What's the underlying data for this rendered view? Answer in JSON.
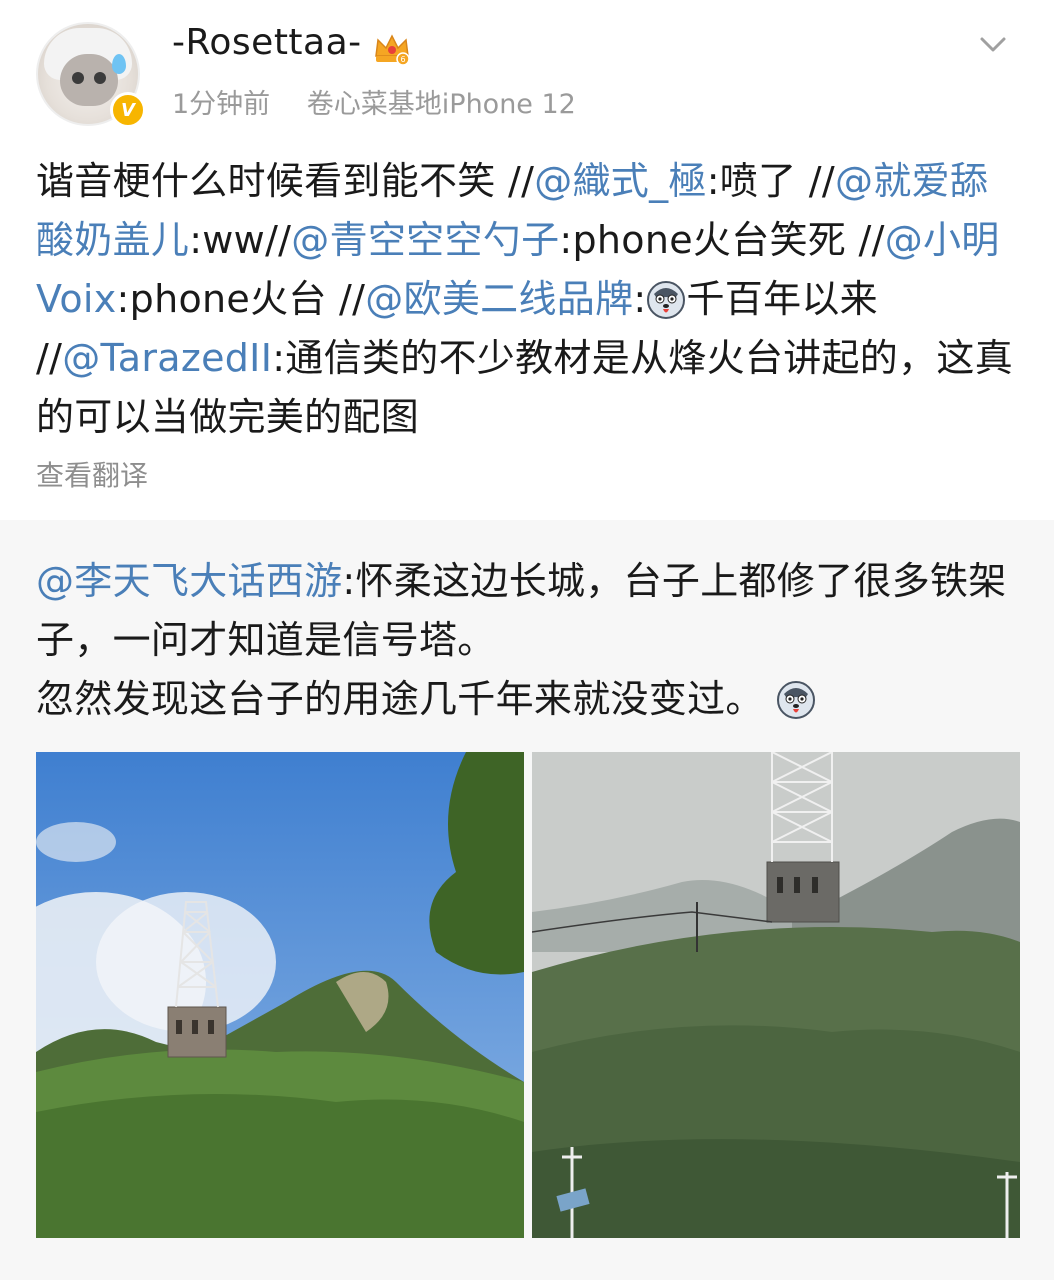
{
  "author": {
    "name": "-Rosettaa-",
    "verified_badge": "V",
    "crown_badge": "crown-level-badge",
    "time": "1分钟前",
    "source": "卷心菜基地iPhone 12"
  },
  "post": {
    "segments": [
      {
        "text": "谐音梗什么时候看到能不笑 //",
        "type": "text"
      },
      {
        "text": "@織式_極",
        "type": "mention"
      },
      {
        "text": ":喷了 //",
        "type": "text"
      },
      {
        "text": "@就爱舔酸奶盖儿",
        "type": "mention"
      },
      {
        "text": ":ww//",
        "type": "text"
      },
      {
        "text": "@青空空空勺子",
        "type": "mention"
      },
      {
        "text": ":phone火台笑死 //",
        "type": "text"
      },
      {
        "text": "@小明Voix",
        "type": "mention"
      },
      {
        "text": ":phone火台 //",
        "type": "text"
      },
      {
        "text": "@欧美二线品牌",
        "type": "mention"
      },
      {
        "text": ":",
        "type": "text"
      },
      {
        "text": "千百年以来 //",
        "type": "text"
      },
      {
        "text": "@TarazedII",
        "type": "mention"
      },
      {
        "text": ":通信类的不少教材是从烽火台讲起的，这真的可以当做完美的配图",
        "type": "text"
      }
    ],
    "translate_label": "查看翻译"
  },
  "repost": {
    "mention": "@李天飞大话西游",
    "text_line1": ":怀柔这边长城，台子上都修了很多铁架子，一问才知道是信号塔。",
    "text_line2": "忽然发现这台子的用途几千年来就没变过。",
    "images": [
      "great-wall-tower-photo-1",
      "great-wall-tower-photo-2"
    ]
  },
  "colors": {
    "mention": "#4a7fb8",
    "meta": "#9a9a9a",
    "repost_bg": "#f7f7f7",
    "verified": "#f7b500"
  }
}
